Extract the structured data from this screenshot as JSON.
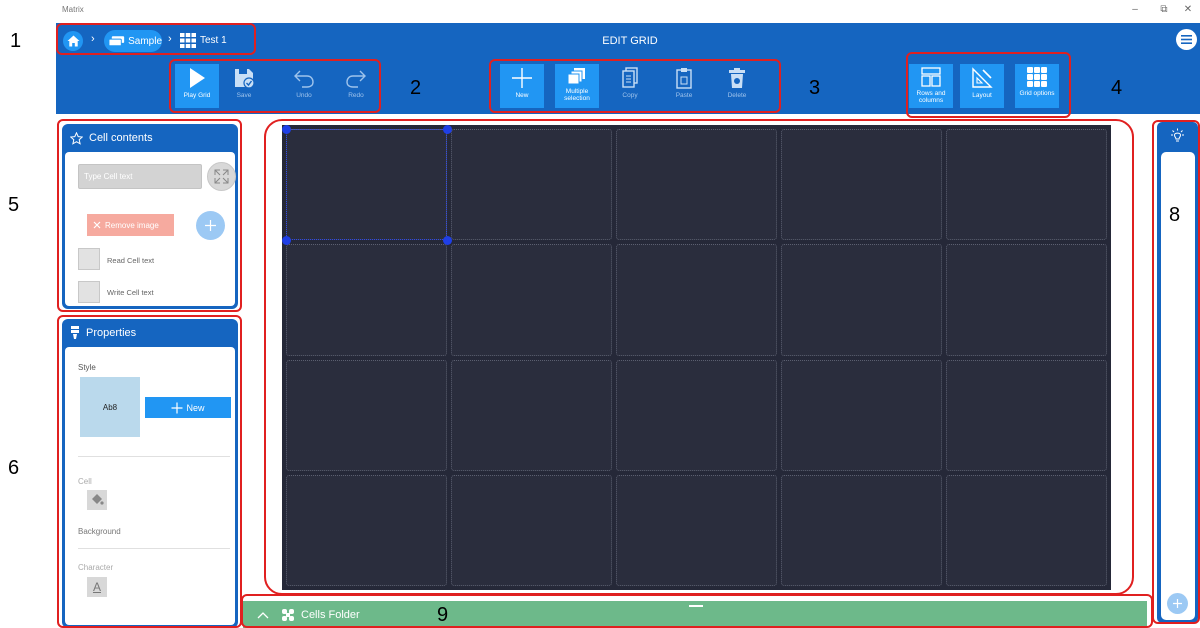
{
  "window": {
    "app_title": "Matrix",
    "minimize": "–",
    "restore": "⧉",
    "close": "✕"
  },
  "breadcrumb": {
    "sep": "›",
    "pill_label": "Sample",
    "grid_label": "Test 1"
  },
  "header": {
    "title": "EDIT GRID"
  },
  "toolbar": {
    "play": "Play Grid",
    "save": "Save",
    "undo": "Undo",
    "redo": "Redo",
    "new": "New",
    "multiple_selection": "Multiple selection",
    "copy": "Copy",
    "paste": "Paste",
    "delete": "Delete",
    "rows_and_columns": "Rows and columns",
    "layout": "Layout",
    "grid_options": "Grid options"
  },
  "cell_contents": {
    "title": "Cell contents",
    "text_placeholder": "Type Cell text",
    "remove_image": "Remove image",
    "read_cell_text": "Read Cell text",
    "write_cell_text": "Write Cell text"
  },
  "properties": {
    "title": "Properties",
    "style_label": "Style",
    "style_preview": "Ab8",
    "new_style": "New",
    "cell_label": "Cell",
    "background_label": "Background",
    "character_label": "Character",
    "font_glyph": "A"
  },
  "grid": {
    "rows": 4,
    "columns": 5,
    "selected_cell": {
      "row": 1,
      "column": 1
    }
  },
  "folder_bar": {
    "label": "Cells Folder"
  },
  "annotations": [
    "1",
    "2",
    "3",
    "4",
    "5",
    "6",
    "8",
    "9"
  ],
  "colors": {
    "accent": "#1565c0",
    "button": "#2196f3",
    "grid_bg": "#252838",
    "annotation": "#e02020",
    "folder_bar": "#6db98a"
  }
}
